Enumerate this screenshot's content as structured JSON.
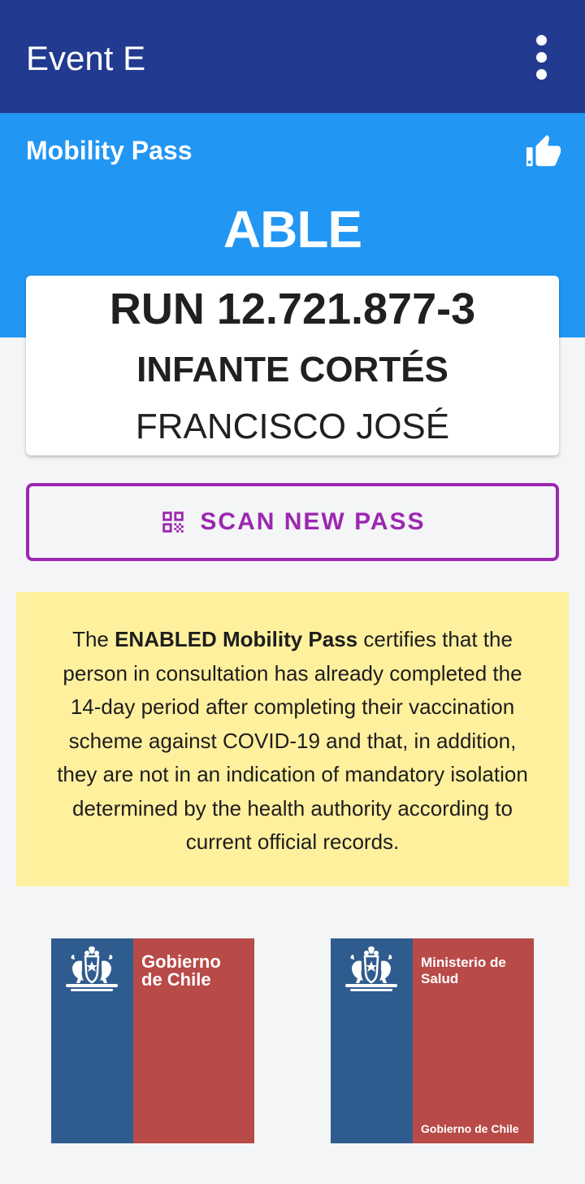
{
  "appbar": {
    "title": "Event E",
    "menu_icon": "more-vertical-icon"
  },
  "status": {
    "label": "Mobility Pass",
    "icon": "thumbs-up-icon",
    "value": "ABLE",
    "color": "#2196f3"
  },
  "person": {
    "run": "RUN 12.721.877-3",
    "surname": "INFANTE CORTÉS",
    "given_names": "FRANCISCO JOSÉ"
  },
  "scan_button": {
    "label": "SCAN NEW PASS",
    "icon": "qr-code-icon",
    "color": "#9c27b0"
  },
  "info": {
    "lead": "The ",
    "bold": "ENABLED Mobility Pass",
    "rest": " certifies that the person in consultation has already completed the 14-day period after completing their vaccination scheme against COVID-19 and that, in addition, they are not in an indication of mandatory isolation determined by the health authority according to current official records."
  },
  "logos": [
    {
      "line1": "Gobierno",
      "line2": "de Chile",
      "footer": ""
    },
    {
      "line1": "Ministerio de",
      "line2": "Salud",
      "footer": "Gobierno de Chile"
    }
  ],
  "colors": {
    "appbar": "#223a8f",
    "logo_blue": "#2f5c8f",
    "logo_red": "#b84a48",
    "info_bg": "#fff09e"
  }
}
